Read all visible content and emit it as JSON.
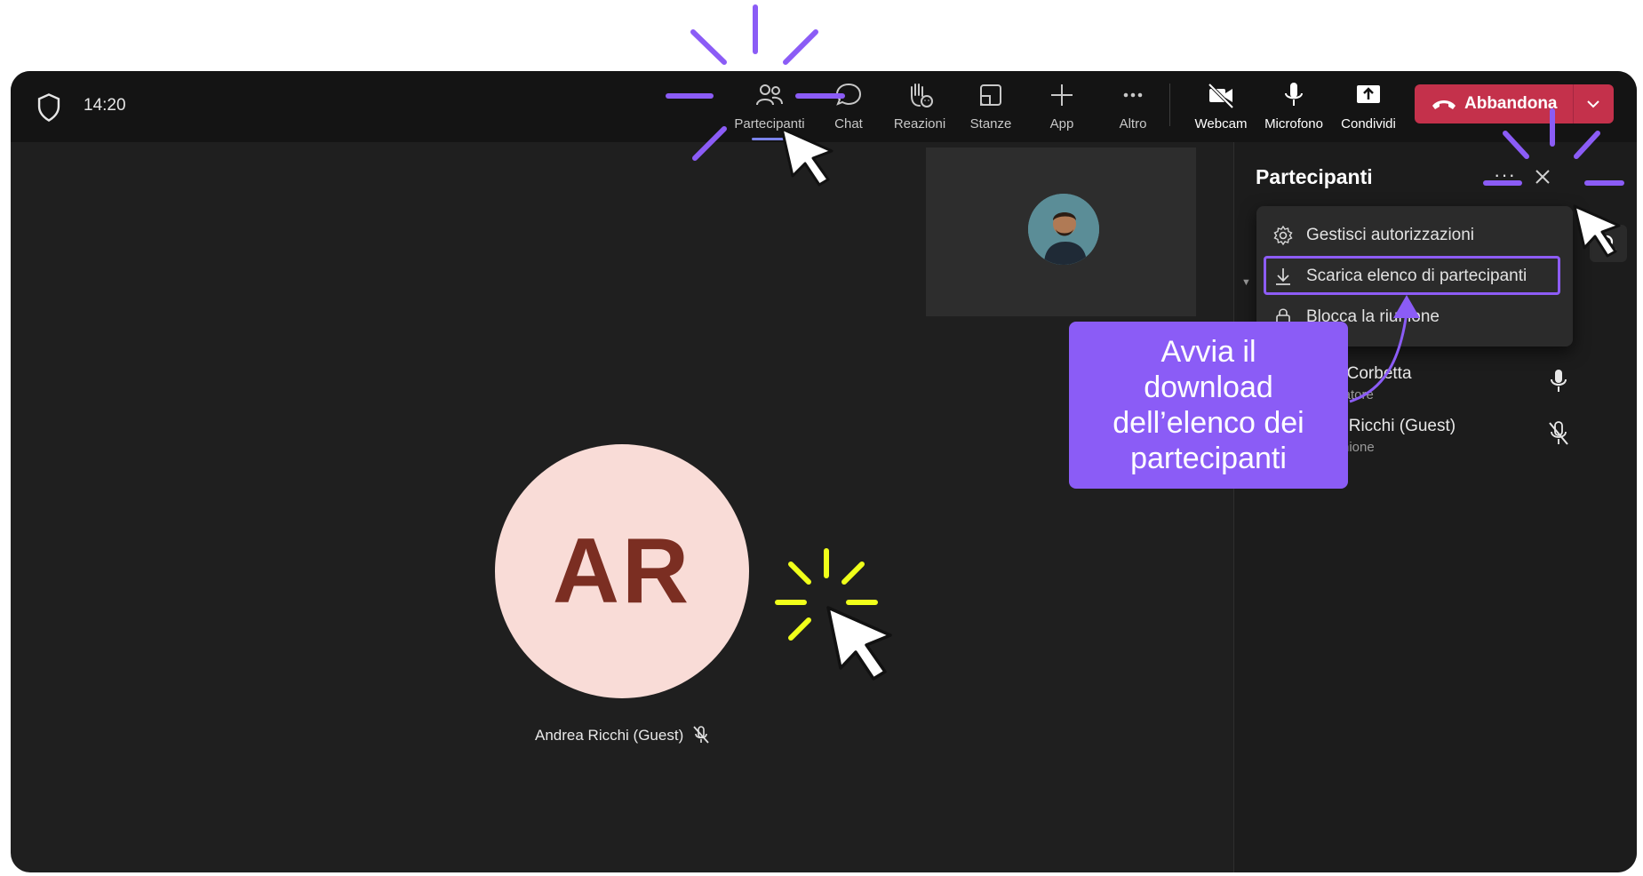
{
  "topbar": {
    "time": "14:20",
    "buttons": {
      "participants": "Partecipanti",
      "chat": "Chat",
      "reactions": "Reazioni",
      "rooms": "Stanze",
      "apps": "App",
      "more": "Altro",
      "webcam": "Webcam",
      "microphone": "Microfono",
      "share": "Condividi"
    },
    "leave_label": "Abbandona"
  },
  "stage": {
    "main_initials": "AR",
    "main_name": "Andrea Ricchi (Guest)"
  },
  "panel": {
    "title": "Partecipanti",
    "more_label": "···",
    "participants": [
      {
        "name": "ele Corbetta",
        "role": "nizzatore"
      },
      {
        "name": "rea Ricchi (Guest)",
        "role": "t riunione"
      }
    ]
  },
  "menu": {
    "items": [
      {
        "label": "Gestisci autorizzazioni",
        "icon": "gear-icon"
      },
      {
        "label": "Scarica elenco di partecipanti",
        "icon": "download-icon"
      },
      {
        "label": "Blocca la riunione",
        "icon": "lock-icon"
      }
    ]
  },
  "callout": {
    "lines": [
      "Avvia il",
      "download",
      "dell’elenco dei",
      "partecipanti"
    ]
  },
  "colors": {
    "accent": "#8b5cf6",
    "leave": "#c4314b",
    "avatar_bg": "#f9dcd7",
    "avatar_text": "#7b2e22",
    "sparkle_yellow": "#f0ff1a"
  }
}
